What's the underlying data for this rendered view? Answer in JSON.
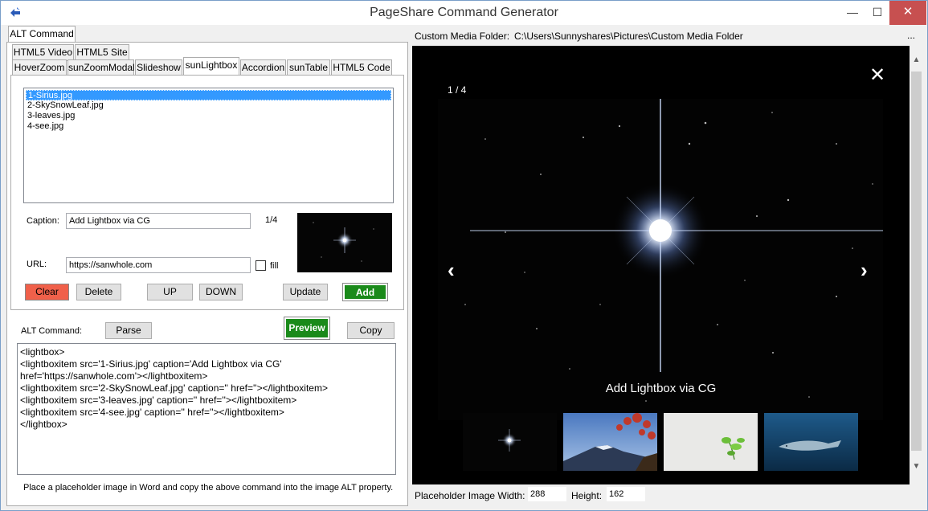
{
  "window": {
    "title": "PageShare Command Generator",
    "minimize": "—",
    "maximize": "☐",
    "close": "✕"
  },
  "tabs": {
    "top": [
      "ALT Command"
    ],
    "row1": [
      "HTML5 Video",
      "HTML5 Site"
    ],
    "row2": [
      "HoverZoom",
      "sunZoomModal",
      "Slideshow",
      "sunLightbox",
      "Accordion",
      "sunTable",
      "HTML5 Code"
    ],
    "active": "sunLightbox"
  },
  "images_list": {
    "items": [
      "1-Sirius.jpg",
      "2-SkySnowLeaf.jpg",
      "3-leaves.jpg",
      "4-see.jpg"
    ],
    "selected_index": 0
  },
  "form": {
    "caption_label": "Caption:",
    "caption_value": "Add Lightbox via CG",
    "index_display": "1/4",
    "url_label": "URL:",
    "url_value": "https://sanwhole.com",
    "fill_label": "fill",
    "fill_checked": false
  },
  "buttons": {
    "clear": "Clear",
    "delete": "Delete",
    "up": "UP",
    "down": "DOWN",
    "update": "Update",
    "add": "Add",
    "parse": "Parse",
    "preview": "Preview",
    "copy": "Copy"
  },
  "command": {
    "label": "ALT Command:",
    "lines": [
      "<lightbox>",
      "<lightboxitem src='1-Sirius.jpg' caption='Add Lightbox via CG'",
      "href='https://sanwhole.com'></lightboxitem>",
      "<lightboxitem src='2-SkySnowLeaf.jpg' caption='' href=''></lightboxitem>",
      "<lightboxitem src='3-leaves.jpg' caption='' href=''></lightboxitem>",
      "<lightboxitem src='4-see.jpg' caption='' href=''></lightboxitem>",
      "</lightbox>"
    ],
    "hint": "Place a placeholder image in Word and copy the above command into the image ALT property."
  },
  "media_folder": {
    "label": "Custom Media Folder:",
    "path": "C:\\Users\\Sunnyshares\\Pictures\\Custom Media Folder",
    "more": "..."
  },
  "preview": {
    "counter": "1 / 4",
    "close_icon": "close-icon",
    "prev": "‹",
    "next": "›",
    "close_glyph": "✕",
    "caption": "Add Lightbox via CG"
  },
  "placeholder": {
    "width_label": "Placeholder Image Width:",
    "width_value": "288",
    "height_label": "Height:",
    "height_value": "162"
  }
}
